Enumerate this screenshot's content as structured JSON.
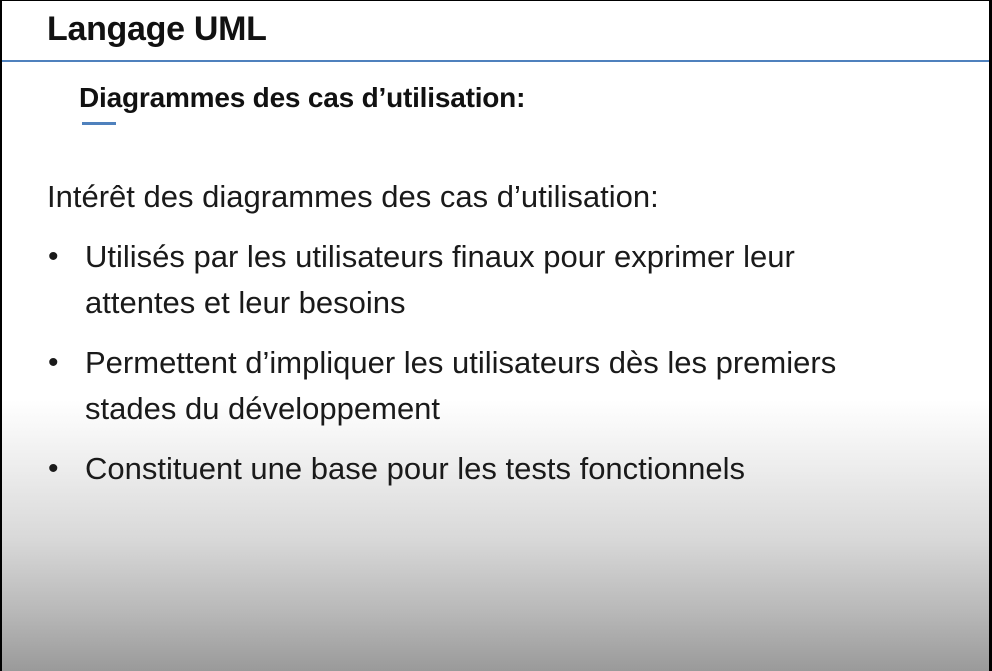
{
  "slide": {
    "title": "Langage UML",
    "subtitle": "Diagrammes des cas d’utilisation:",
    "intro": "Intérêt des diagrammes des cas d’utilisation:",
    "bullet_symbol": "•",
    "bullets": [
      {
        "lines": [
          "Utilisés par les utilisateurs finaux pour exprimer leur",
          "attentes et leur besoins"
        ]
      },
      {
        "lines": [
          "Permettent d’impliquer les utilisateurs dès les premiers",
          "stades du développement"
        ]
      },
      {
        "lines": [
          "Constituent une base pour les tests fonctionnels"
        ]
      }
    ],
    "accent_color": "#4f81bd",
    "text_color": "#1a1a1a"
  }
}
